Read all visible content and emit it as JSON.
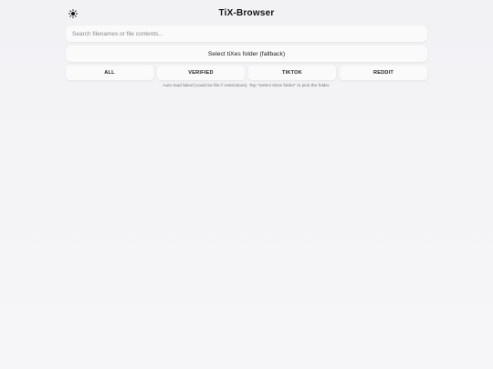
{
  "app": {
    "title": "TiX-Browser",
    "theme_icon": "sun-icon"
  },
  "search": {
    "placeholder": "Search filenames or file contents..."
  },
  "folder_button": {
    "label": "Select tiXes folder (fallback)"
  },
  "tabs": [
    {
      "label": "ALL"
    },
    {
      "label": "VERIFIED"
    },
    {
      "label": "TIKTOK"
    },
    {
      "label": "REDDIT"
    }
  ],
  "status": {
    "message": "Auto-load failed (could be file:// restrictions). Tap \"Select tiXes folder\" to pick the folder."
  }
}
